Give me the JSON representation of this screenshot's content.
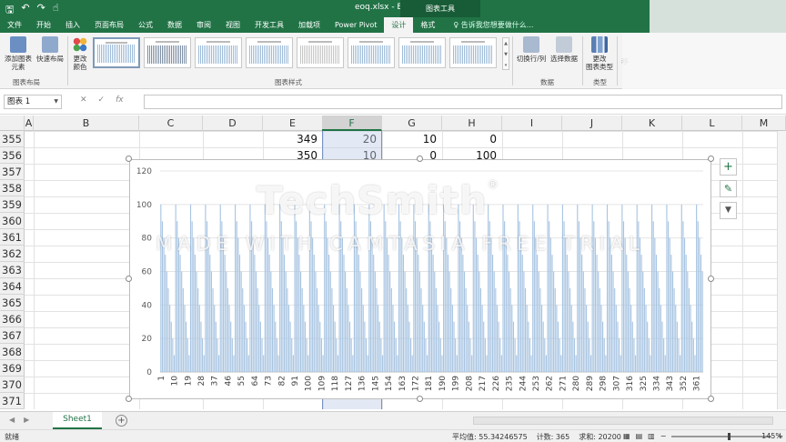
{
  "titlebar": {
    "title": "eoq.xlsx - Excel",
    "context_tool": "图表工具",
    "qat_save": "🖫",
    "qat_undo": "↶",
    "qat_redo": "↷",
    "qat_touch": "☝"
  },
  "tabs": [
    "文件",
    "开始",
    "插入",
    "页面布局",
    "公式",
    "数据",
    "审阅",
    "视图",
    "开发工具",
    "加载项",
    "Power Pivot",
    "设计",
    "格式"
  ],
  "active_tab": "设计",
  "tell_me": "♀ 告诉我您想要做什么...",
  "ribbon": {
    "add_element": "添加图表\n元素",
    "quick_layout": "快速布局",
    "change_colors": "更改\n颜色",
    "group_layout": "图表布局",
    "group_styles": "图表样式",
    "switch_row_col": "切换行/列",
    "select_data": "选择数据",
    "group_data": "数据",
    "change_type": "更改\n图表类型",
    "group_type": "类型",
    "move": "移"
  },
  "formula_bar": {
    "name_box": "图表 1",
    "cancel": "✕",
    "enter": "✓",
    "fx": "fx",
    "formula": ""
  },
  "columns": [
    "A",
    "B",
    "C",
    "D",
    "E",
    "F",
    "G",
    "H",
    "I",
    "J",
    "K",
    "L",
    "M"
  ],
  "rows": [
    "355",
    "356",
    "357",
    "358",
    "359",
    "360",
    "361",
    "362",
    "363",
    "364",
    "365",
    "366",
    "367",
    "368",
    "369",
    "370",
    "371"
  ],
  "cell_values": {
    "r355": {
      "E": "349",
      "F": "20",
      "G": "10",
      "H": "0"
    },
    "r356": {
      "E": "350",
      "F": "10",
      "G": "0",
      "H": "100"
    }
  },
  "chart_data": {
    "type": "bar",
    "x_tick_labels": [
      "1",
      "10",
      "19",
      "28",
      "37",
      "46",
      "55",
      "64",
      "73",
      "82",
      "91",
      "100",
      "109",
      "118",
      "127",
      "136",
      "145",
      "154",
      "163",
      "172",
      "181",
      "190",
      "199",
      "208",
      "217",
      "226",
      "235",
      "244",
      "253",
      "262",
      "271",
      "280",
      "289",
      "298",
      "307",
      "316",
      "325",
      "334",
      "343",
      "352",
      "361"
    ],
    "x_range": [
      1,
      365
    ],
    "ylim": [
      0,
      120
    ],
    "y_ticks": [
      0,
      20,
      40,
      60,
      80,
      100,
      120
    ],
    "pattern": {
      "period": 10,
      "values": [
        100,
        90,
        80,
        70,
        60,
        50,
        40,
        30,
        20,
        10
      ]
    },
    "series_color": "#a9c5e2",
    "grid": true,
    "legend": "none"
  },
  "watermark": {
    "logo": "TechSmith",
    "registered": "®",
    "line": "MADE WITH CAMTASIA FREE TRIAL"
  },
  "side_buttons": {
    "add": "+",
    "style": "✎",
    "filter": "▼"
  },
  "sheet_tabs": {
    "sheet": "Sheet1",
    "add": "+"
  },
  "status": {
    "ready": "就绪",
    "average": "平均值: 55.34246575",
    "count": "计数: 365",
    "sum": "求和: 20200",
    "zoom": "145%"
  },
  "colors": {
    "excel_green": "#217346",
    "bar": "#a9c5e2",
    "selection": "#7a93c4"
  }
}
